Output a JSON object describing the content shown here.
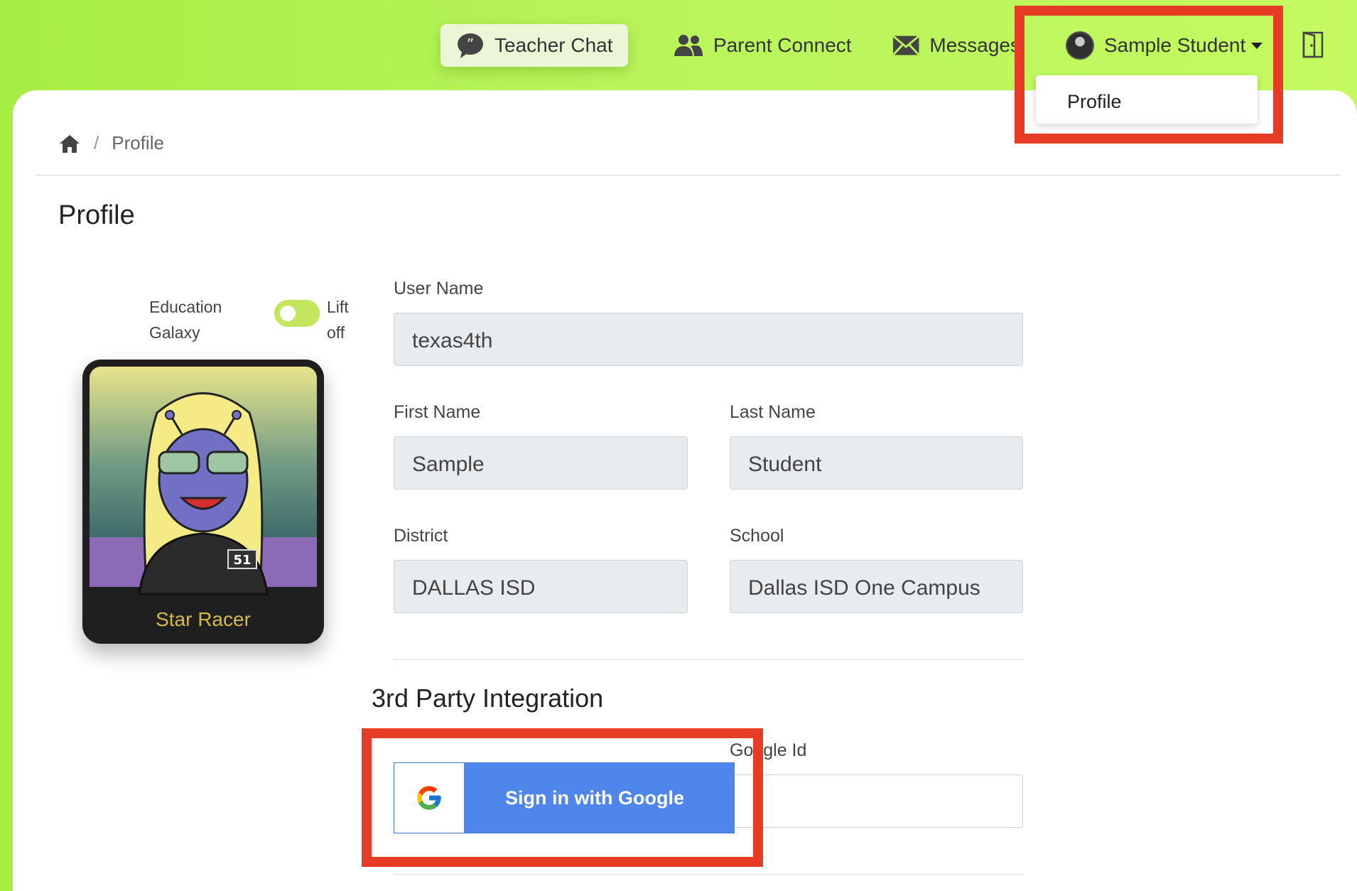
{
  "nav": {
    "teacher_chat": "Teacher Chat",
    "parent_connect": "Parent Connect",
    "messages": "Messages",
    "user_name": "Sample Student"
  },
  "dropdown": {
    "profile": "Profile"
  },
  "breadcrumb": {
    "current": "Profile"
  },
  "page": {
    "title": "Profile"
  },
  "toggle": {
    "left_label_1": "Education",
    "left_label_2": "Galaxy",
    "right_label_1": "Lift",
    "right_label_2": "off"
  },
  "card": {
    "name": "Star Racer"
  },
  "form": {
    "username_label": "User Name",
    "username_value": "texas4th",
    "firstname_label": "First Name",
    "firstname_value": "Sample",
    "lastname_label": "Last Name",
    "lastname_value": "Student",
    "district_label": "District",
    "district_value": "DALLAS ISD",
    "school_label": "School",
    "school_value": "Dallas ISD One Campus"
  },
  "integration": {
    "title": "3rd Party Integration",
    "google_id_label": "Google Id",
    "google_button": "Sign in with Google"
  },
  "colors": {
    "highlight": "#e63b25",
    "google_blue": "#4f86ec",
    "header_green": "#b8f45a"
  }
}
